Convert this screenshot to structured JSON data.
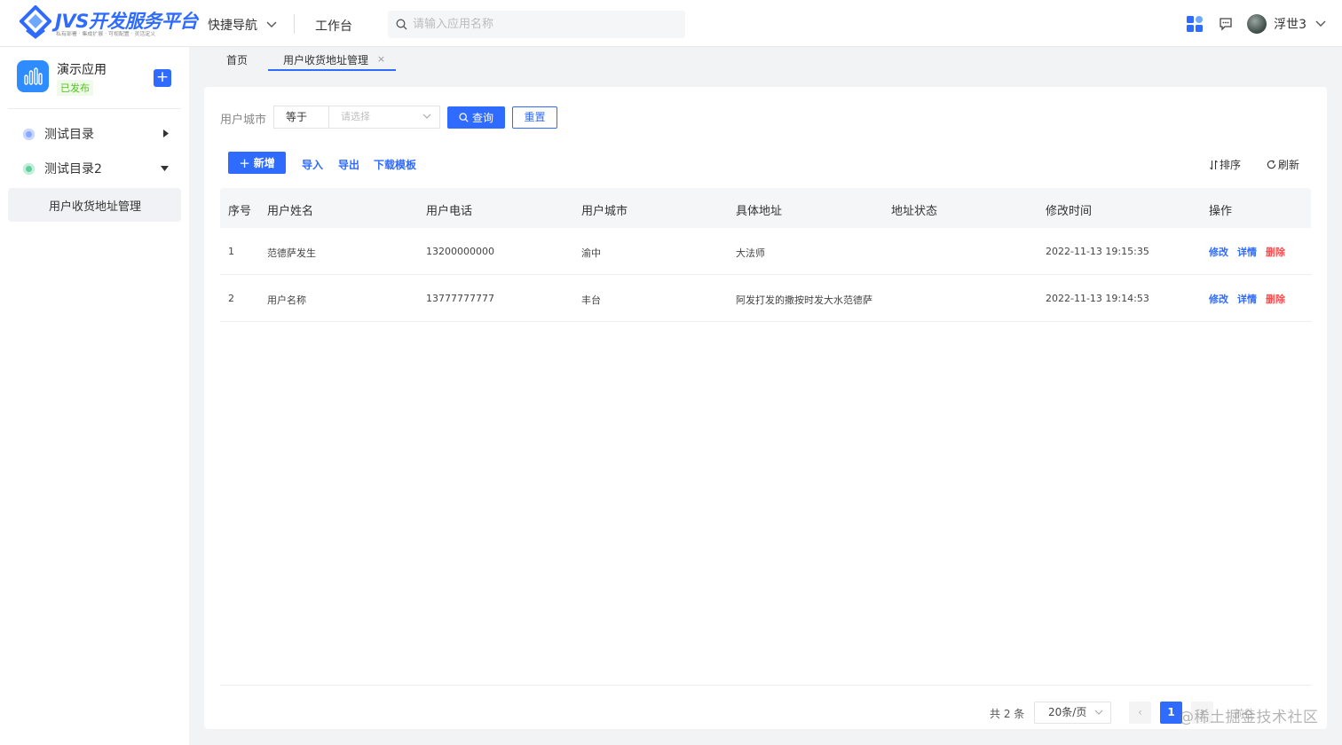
{
  "header": {
    "logo_title": "JVS开发服务平台",
    "logo_subtitle": "私有部署 · 集成扩展 · 可视配置 · 灵活定义",
    "quick_nav_label": "快捷导航",
    "workbench_label": "工作台",
    "search_placeholder": "请输入应用名称",
    "user_name": "浮世3"
  },
  "sidebar": {
    "app_name": "演示应用",
    "app_status": "已发布",
    "items": [
      {
        "label": "测试目录"
      },
      {
        "label": "测试目录2"
      }
    ],
    "sub_item": "用户收货地址管理"
  },
  "tabs": [
    {
      "label": "首页"
    },
    {
      "label": "用户收货地址管理"
    }
  ],
  "filter": {
    "field_label": "用户城市",
    "operator": "等于",
    "value_placeholder": "请选择",
    "query_label": "查询",
    "reset_label": "重置"
  },
  "toolbar": {
    "add_label": "新增",
    "import_label": "导入",
    "export_label": "导出",
    "template_label": "下载模板",
    "sort_label": "排序",
    "refresh_label": "刷新"
  },
  "table": {
    "headers": [
      "序号",
      "用户姓名",
      "用户电话",
      "用户城市",
      "具体地址",
      "地址状态",
      "修改时间",
      "操作"
    ],
    "rows": [
      {
        "index": "1",
        "name": "范德萨发生",
        "phone": "13200000000",
        "city": "渝中",
        "address": "大法师",
        "status": "",
        "modified": "2022-11-13 19:15:35"
      },
      {
        "index": "2",
        "name": "用户名称",
        "phone": "13777777777",
        "city": "丰台",
        "address": "阿发打发的撒按时发大水范德萨",
        "status": "",
        "modified": "2022-11-13 19:14:53"
      }
    ],
    "actions": {
      "edit": "修改",
      "detail": "详情",
      "delete": "删除"
    }
  },
  "pagination": {
    "total_text": "共 2 条",
    "page_size": "20条/页",
    "current_page": "1",
    "goto_text": "前往"
  },
  "watermark": "@稀土掘金技术社区",
  "colors": {
    "primary": "#2f6bff",
    "danger": "#ff4d4f",
    "success": "#52c41a"
  }
}
